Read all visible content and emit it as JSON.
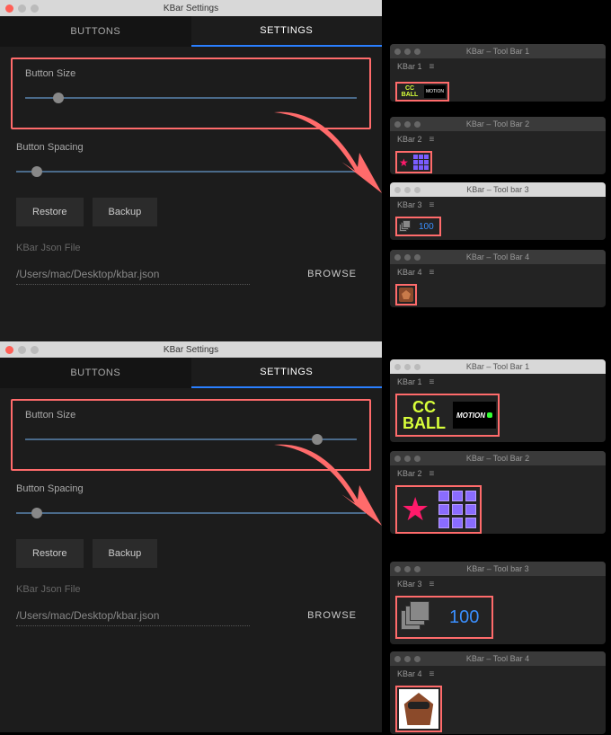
{
  "settings": {
    "window_title": "KBar Settings",
    "tabs": {
      "buttons": "BUTTONS",
      "settings": "SETTINGS"
    },
    "button_size_label": "Button Size",
    "button_spacing_label": "Button Spacing",
    "restore_label": "Restore",
    "backup_label": "Backup",
    "json_file_label": "KBar Json File",
    "json_file_path": "/Users/mac/Desktop/kbar.json",
    "browse_label": "BROWSE",
    "size_slider_top_pct": 10,
    "size_slider_bottom_pct": 88,
    "spacing_slider_pct": 6
  },
  "toolbars": {
    "bar1": {
      "title": "KBar – Tool Bar 1",
      "header": "KBar 1",
      "cc": "CC",
      "ball": "BALL",
      "motion": "MOTION"
    },
    "bar2": {
      "title": "KBar – Tool Bar 2",
      "header": "KBar 2"
    },
    "bar3": {
      "title": "KBar – Tool bar 3",
      "header": "KBar 3",
      "num": "100"
    },
    "bar4": {
      "title": "KBar – Tool Bar 4",
      "header": "KBar 4"
    }
  }
}
